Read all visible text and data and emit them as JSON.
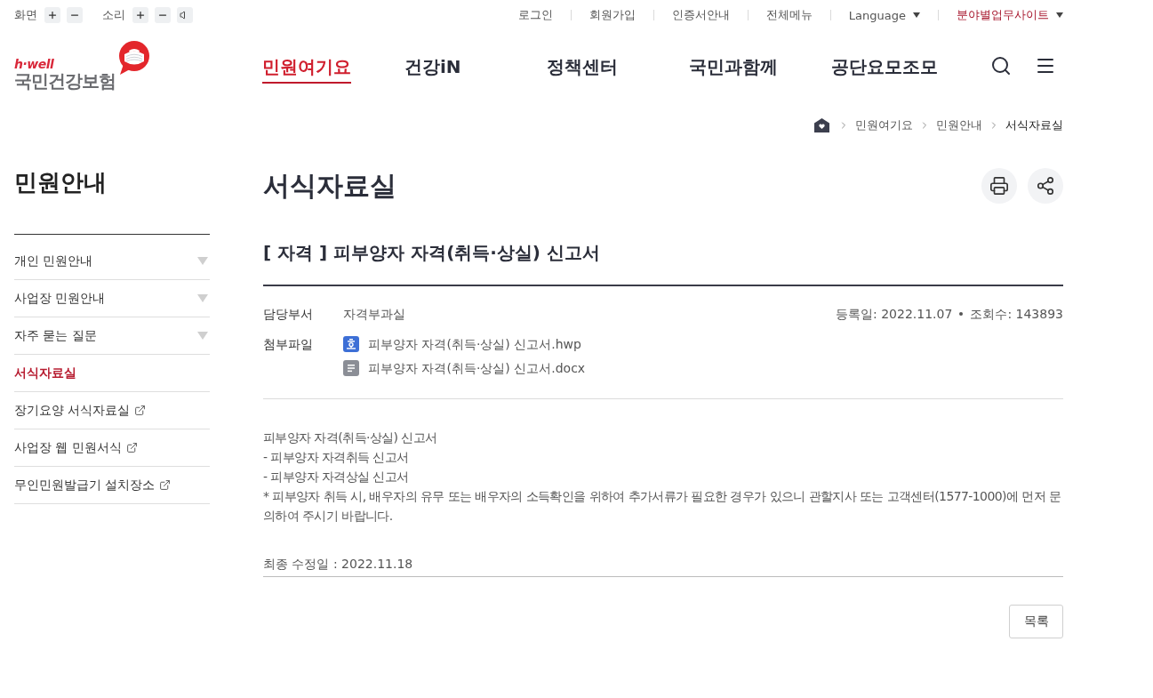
{
  "utility_bar": {
    "controls": [
      {
        "label": "화면",
        "buttons": [
          {
            "kind": "plus"
          },
          {
            "kind": "minus"
          }
        ]
      },
      {
        "label": "소리",
        "buttons": [
          {
            "kind": "plus"
          },
          {
            "kind": "minus"
          },
          {
            "kind": "speaker"
          }
        ]
      }
    ],
    "links": [
      {
        "label": "로그인",
        "kind": "link"
      },
      {
        "label": "회원가입",
        "kind": "link"
      },
      {
        "label": "인증서안내",
        "kind": "link"
      },
      {
        "label": "전체메뉴",
        "kind": "link"
      },
      {
        "label": "Language",
        "kind": "dropdown"
      },
      {
        "label": "분야별업무사이트",
        "kind": "featured"
      }
    ]
  },
  "logo": {
    "tagline": "h·well",
    "name": "국민건강보험"
  },
  "nav": {
    "items": [
      {
        "label": "민원여기요",
        "selected": true
      },
      {
        "label": "건강iN",
        "selected": false
      },
      {
        "label": "정책센터",
        "selected": false
      },
      {
        "label": "국민과함께",
        "selected": false
      },
      {
        "label": "공단요모조모",
        "selected": false
      }
    ]
  },
  "breadcrumb": [
    "민원여기요",
    "민원안내",
    "서식자료실"
  ],
  "sidebar": {
    "title": "민원안내",
    "items": [
      {
        "label": "개인 민원안내",
        "kind": "submenu",
        "selected": false
      },
      {
        "label": "사업장 민원안내",
        "kind": "submenu",
        "selected": false
      },
      {
        "label": "자주 묻는 질문",
        "kind": "submenu",
        "selected": false
      },
      {
        "label": "서식자료실",
        "kind": "page",
        "selected": true
      },
      {
        "label": "장기요양 서식자료실",
        "kind": "external",
        "selected": false
      },
      {
        "label": "사업장 웹 민원서식",
        "kind": "external",
        "selected": false
      },
      {
        "label": "무인민원발급기 설치장소",
        "kind": "external",
        "selected": false
      }
    ]
  },
  "page_title": "서식자료실",
  "post": {
    "title": "[ 자격 ] 피부양자 자격(취득·상실) 신고서",
    "department": {
      "label": "담당부서",
      "value": "자격부과실"
    },
    "registered": "등록일: 2022.11.07",
    "views": "조회수: 143893",
    "attachments": {
      "label": "첨부파일",
      "files": [
        {
          "name": "피부양자 자격(취득·상실) 신고서.hwp",
          "kind": "hwp"
        },
        {
          "name": "피부양자 자격(취득·상실) 신고서.docx",
          "kind": "docx"
        }
      ]
    },
    "body": [
      "피부양자 자격(취득·상실) 신고서",
      "- 피부양자 자격취득 신고서",
      "- 피부양자 자격상실 신고서",
      "* 피부양자 취득 시, 배우자의 유무 또는 배우자의 소득확인을 위하여 추가서류가 필요한 경우가 있으니 관할지사 또는 고객센터(1577-1000)에 먼저 문의하여 주시기 바랍니다."
    ],
    "last_modified": "최종 수정일 : 2022.11.18"
  },
  "list_button": "목록"
}
